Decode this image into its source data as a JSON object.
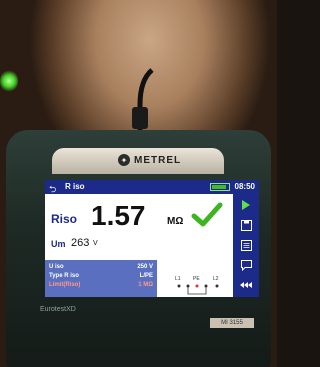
{
  "brand": "METREL",
  "header": {
    "title": "R iso",
    "time": "08:50"
  },
  "measurement": {
    "label": "Riso",
    "value": "1.57",
    "unit": "MΩ",
    "um_label": "Um",
    "um_value": "263",
    "um_unit": "V"
  },
  "params": [
    {
      "name": "U iso",
      "value": "250 V",
      "limit": false
    },
    {
      "name": "Type R iso",
      "value": "L/PE",
      "limit": false
    },
    {
      "name": "Limit(Riso)",
      "value": "1 MΩ",
      "limit": true
    }
  ],
  "terminals": [
    "L1",
    "PE",
    "L2"
  ],
  "bezel_text": "EurotestXD",
  "model": "MI 3155",
  "colors": {
    "accent": "#1c2a8a",
    "ok": "#3cb521",
    "panel": "#5a6fbf"
  }
}
